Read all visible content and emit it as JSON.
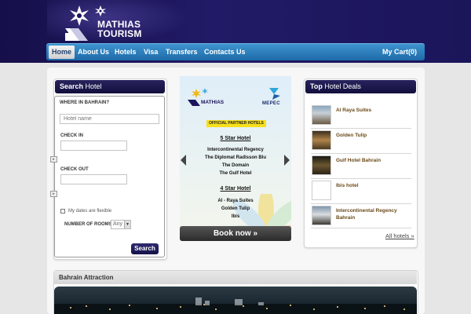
{
  "brand": {
    "line1": "MATHIAS",
    "line2": "TOURISM"
  },
  "nav": {
    "items": [
      "Home",
      "About Us",
      "Hotels",
      "Visa",
      "Transfers",
      "Contacts Us"
    ],
    "cart": "My Cart(0)"
  },
  "search": {
    "title_bold": "Search",
    "title_rest": " Hotel",
    "where_label": "WHERE IN BAHRAIN?",
    "hotel_placeholder": "Hotel name",
    "checkin_label": "CHECK IN",
    "checkout_label": "CHECK OUT",
    "flexible_label": "My dates are flexible",
    "rooms_label": "NUMBER OF ROOMS",
    "rooms_value": "Any",
    "button": "Search"
  },
  "banner": {
    "partner_strip": "OFFICIAL PARTNER HOTELS",
    "mepec": "MEPEC",
    "five_star_heading": "5 Star Hotel",
    "five_star": [
      "Intercontinental Regency",
      "The Diplomat Radisson Blu",
      "The Domain",
      "The Gulf Hotel"
    ],
    "four_star_heading": "4 Star Hotel",
    "four_star": [
      "Al - Raya Suites",
      "Golden Tulip",
      "Ibis"
    ],
    "book_now": "Book now »",
    "colors": {
      "strip": "#f7e01c",
      "button": "#333333"
    }
  },
  "deals": {
    "title_bold": "Top",
    "title_rest": " Hotel Deals",
    "items": [
      {
        "name": "Al Raya Suites"
      },
      {
        "name": "Golden Tulip"
      },
      {
        "name": "Gulf Hotel Bahrain"
      },
      {
        "name": "Ibis hotel"
      },
      {
        "name": "Intercontinental Regency Bahrain"
      }
    ],
    "all_link": "All hotels »"
  },
  "attraction": {
    "title": "Bahrain Attraction"
  },
  "colors": {
    "header": "#1b155a",
    "nav": "#2a7dbd",
    "panel_title": "#1b1850",
    "deal_text": "#6a4a18"
  }
}
